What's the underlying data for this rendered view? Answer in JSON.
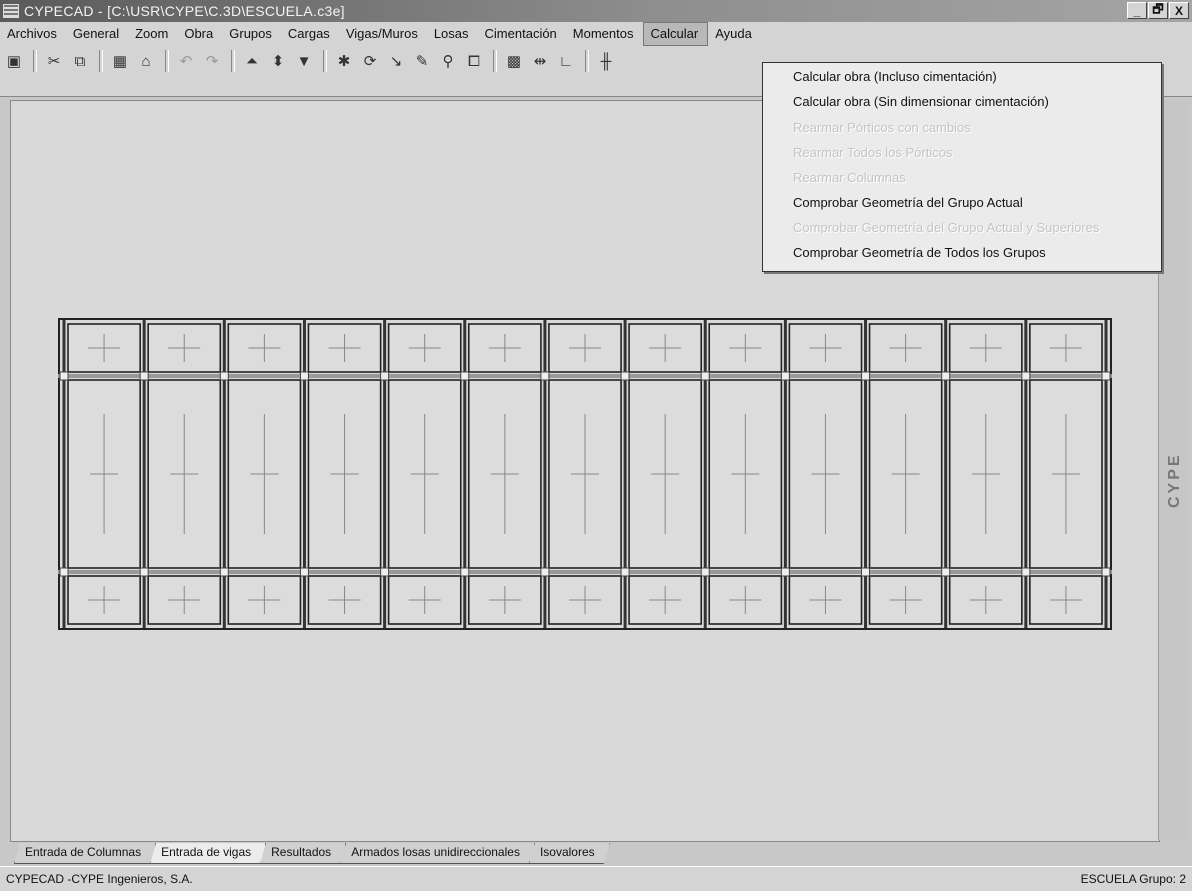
{
  "window": {
    "title": "CYPECAD - [C:\\USR\\CYPE\\C.3D\\ESCUELA.c3e]",
    "controls": [
      "_",
      "🗗",
      "X"
    ]
  },
  "menu": [
    {
      "label": "Archivos"
    },
    {
      "label": "General"
    },
    {
      "label": "Zoom"
    },
    {
      "label": "Obra"
    },
    {
      "label": "Grupos"
    },
    {
      "label": "Cargas"
    },
    {
      "label": "Vigas/Muros"
    },
    {
      "label": "Losas"
    },
    {
      "label": "Cimentación"
    },
    {
      "label": "Momentos"
    },
    {
      "label": "Calcular"
    },
    {
      "label": "Ayuda"
    }
  ],
  "calcular_menu": [
    {
      "label": "Calcular obra (Incluso cimentación)",
      "enabled": true
    },
    {
      "label": "Calcular obra (Sin dimensionar cimentación)",
      "enabled": true
    },
    {
      "label": "Rearmar Pórticos con cambios",
      "enabled": false
    },
    {
      "label": "Rearmar Todos los Pórticos",
      "enabled": false
    },
    {
      "label": "Rearmar Columnas",
      "enabled": false
    },
    {
      "label": "Comprobar Geometría del Grupo Actual",
      "enabled": true
    },
    {
      "label": "Comprobar Geometría del Grupo Actual y Superiores",
      "enabled": false
    },
    {
      "label": "Comprobar Geometría de Todos los Grupos",
      "enabled": true
    }
  ],
  "toolbar_icons": [
    "save-icon",
    "cut-icon",
    "copy-icon",
    "calculator-icon",
    "home-icon",
    "undo-icon",
    "redo-icon",
    "group-up-icon",
    "group-updown-icon",
    "group-down-icon",
    "wand-icon",
    "rotate-icon",
    "measure-icon",
    "pencil-icon",
    "zoom-icon",
    "window-icon",
    "grid-icon",
    "move-icon",
    "angle-icon",
    "column-icon"
  ],
  "plan": {
    "bays": 13
  },
  "side_logo": "CYPE",
  "tabs": [
    {
      "label": "Entrada de Columnas"
    },
    {
      "label": "Entrada de vigas"
    },
    {
      "label": "Resultados"
    },
    {
      "label": "Armados losas unidireccionales"
    },
    {
      "label": "Isovalores"
    }
  ],
  "status": {
    "left": "CYPECAD -CYPE Ingenieros, S.A.",
    "right": "ESCUELA Grupo: 2"
  }
}
